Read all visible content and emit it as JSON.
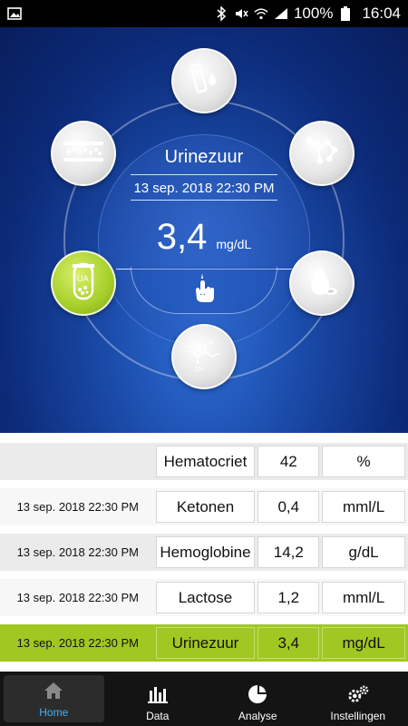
{
  "status_bar": {
    "battery": "100%",
    "time": "16:04",
    "icons": [
      "image-icon",
      "bluetooth-icon",
      "mute-icon",
      "wifi-icon",
      "signal-icon",
      "battery-icon"
    ]
  },
  "measurement": {
    "title": "Urinezuur",
    "datetime": "13 sep. 2018 22:30 PM",
    "value": "3,4",
    "unit": "mg/dL"
  },
  "selector": {
    "items": [
      {
        "name": "test-strip-icon",
        "active": false
      },
      {
        "name": "molecule-icon",
        "active": false
      },
      {
        "name": "blood-drop-icon",
        "active": false
      },
      {
        "name": "lactate-formula-icon",
        "active": false
      },
      {
        "name": "uric-acid-tube-icon",
        "active": true
      },
      {
        "name": "hematocrit-cells-icon",
        "active": false
      }
    ],
    "active_label": "UA"
  },
  "table": {
    "rows": [
      {
        "date": "",
        "name": "Hematocriet",
        "value": "42",
        "unit": "%"
      },
      {
        "date": "13 sep. 2018 22:30 PM",
        "name": "Ketonen",
        "value": "0,4",
        "unit": "mml/L"
      },
      {
        "date": "13 sep. 2018 22:30 PM",
        "name": "Hemoglobine",
        "value": "14,2",
        "unit": "g/dL"
      },
      {
        "date": "13 sep. 2018 22:30 PM",
        "name": "Lactose",
        "value": "1,2",
        "unit": "mml/L"
      },
      {
        "date": "13 sep. 2018 22:30 PM",
        "name": "Urinezuur",
        "value": "3,4",
        "unit": "mg/dL"
      }
    ],
    "selected_index": 4
  },
  "nav": {
    "items": [
      {
        "label": "Home",
        "icon": "home-icon"
      },
      {
        "label": "Data",
        "icon": "bar-chart-icon"
      },
      {
        "label": "Analyse",
        "icon": "pie-chart-icon"
      },
      {
        "label": "Instellingen",
        "icon": "gears-icon"
      }
    ],
    "active_index": 0
  },
  "colors": {
    "accent_green": "#a1c723",
    "nav_active": "#3bb3ff",
    "hero_blue": "#1a4aa8"
  }
}
